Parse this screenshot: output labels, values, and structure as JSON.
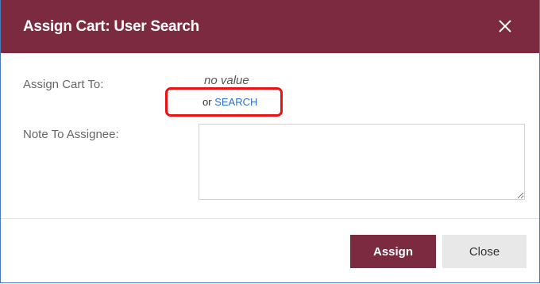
{
  "dialog": {
    "title": "Assign Cart: User Search",
    "header_color": "#7b2a3f",
    "close_icon": "close-icon"
  },
  "form": {
    "assign_label": "Assign Cart To:",
    "assign_value": "no value",
    "or_text": "or",
    "search_link": "SEARCH",
    "note_label": "Note To Assignee:",
    "note_value": ""
  },
  "footer": {
    "assign_button": "Assign",
    "close_button": "Close"
  },
  "annotation": {
    "highlight_color": "#ee1111"
  }
}
